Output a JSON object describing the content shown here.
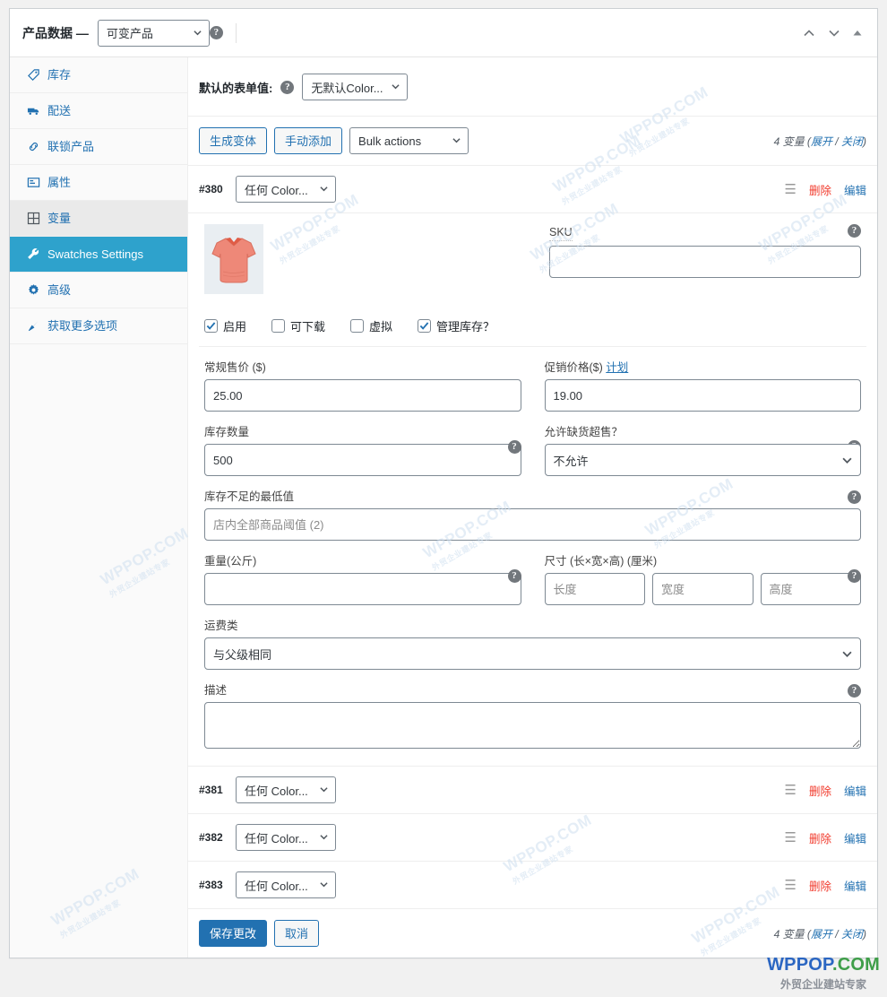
{
  "header": {
    "title": "产品数据 —",
    "product_type": "可变产品",
    "help_icon": "help-icon",
    "move_up_icon": "chevron-up-icon",
    "move_down_icon": "chevron-down-icon",
    "toggle_icon": "toggle-panel-icon"
  },
  "sidebar": {
    "items": [
      {
        "label": "库存",
        "icon": "inventory-icon",
        "state": "normal"
      },
      {
        "label": "配送",
        "icon": "shipping-truck-icon",
        "state": "normal"
      },
      {
        "label": "联锁产品",
        "icon": "link-icon",
        "state": "normal"
      },
      {
        "label": "属性",
        "icon": "attributes-icon",
        "state": "normal"
      },
      {
        "label": "变量",
        "icon": "variations-grid-icon",
        "state": "hover"
      },
      {
        "label": "Swatches Settings",
        "icon": "wrench-icon",
        "state": "active"
      },
      {
        "label": "高级",
        "icon": "gear-icon",
        "state": "normal"
      },
      {
        "label": "获取更多选项",
        "icon": "extensions-icon",
        "state": "normal"
      }
    ]
  },
  "default_form": {
    "label": "默认的表单值:",
    "help_icon": "help-icon",
    "selected": "无默认Color..."
  },
  "toolbar": {
    "generate_label": "生成变体",
    "add_manually_label": "手动添加",
    "bulk_actions_label": "Bulk actions",
    "count_prefix": "4 变量",
    "expand_label": "展开",
    "separator": "/",
    "close_label": "关闭"
  },
  "variations": [
    {
      "id": "#380",
      "attribute": "任何 Color...",
      "handle_icon": "drag-handle-icon",
      "delete_label": "删除",
      "edit_label": "编辑",
      "expanded": true
    },
    {
      "id": "#381",
      "attribute": "任何 Color...",
      "handle_icon": "drag-handle-icon",
      "delete_label": "删除",
      "edit_label": "编辑",
      "expanded": false
    },
    {
      "id": "#382",
      "attribute": "任何 Color...",
      "handle_icon": "drag-handle-icon",
      "delete_label": "删除",
      "edit_label": "编辑",
      "expanded": false
    },
    {
      "id": "#383",
      "attribute": "任何 Color...",
      "handle_icon": "drag-handle-icon",
      "delete_label": "删除",
      "edit_label": "编辑",
      "expanded": false
    }
  ],
  "variation_form": {
    "thumbnail_icon": "tshirt-thumbnail",
    "sku": {
      "label": "SKU",
      "value": "",
      "placeholder": "",
      "help_icon": "help-icon"
    },
    "checkboxes": [
      {
        "label": "启用",
        "checked": true
      },
      {
        "label": "可下载",
        "checked": false
      },
      {
        "label": "虚拟",
        "checked": false
      },
      {
        "label": "管理库存？",
        "checked": true
      }
    ],
    "regular_price": {
      "label": "常规售价 ($)",
      "value": "25.00"
    },
    "sale_price": {
      "label": "促销价格($)",
      "schedule_link": "计划",
      "value": "19.00"
    },
    "stock_qty": {
      "label": "库存数量",
      "value": "500",
      "help_icon": "help-icon"
    },
    "backorders": {
      "label": "允许缺货超售？",
      "selected": "不允许",
      "help_icon": "help-icon"
    },
    "low_stock": {
      "label": "库存不足的最低值",
      "value": "",
      "placeholder": "店内全部商品阈值 (2)",
      "help_icon": "help-icon"
    },
    "weight": {
      "label": "重量(公斤)",
      "value": "",
      "placeholder": "",
      "help_icon": "help-icon"
    },
    "dimensions": {
      "label": "尺寸 (长×宽×高) (厘米)",
      "help_icon": "help-icon",
      "length_placeholder": "长度",
      "width_placeholder": "宽度",
      "height_placeholder": "高度",
      "length": "",
      "width": "",
      "height": ""
    },
    "shipping_class": {
      "label": "运费类",
      "selected": "与父级相同"
    },
    "description": {
      "label": "描述",
      "value": "",
      "help_icon": "help-icon"
    }
  },
  "footer": {
    "save_label": "保存更改",
    "cancel_label": "取消",
    "count_prefix": "4 变量",
    "expand_label": "展开",
    "separator": "/",
    "close_label": "关闭"
  },
  "watermarks": {
    "tile_line1": "WPPOP.COM",
    "tile_line2": "外贸企业建站专家",
    "brand_main": "WPPOP",
    "brand_dot": ".",
    "brand_com": "COM",
    "brand_sub": "外贸企业建站专家"
  }
}
